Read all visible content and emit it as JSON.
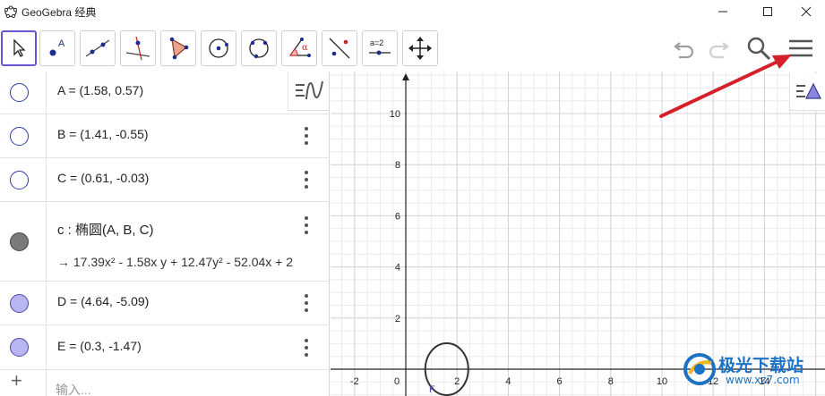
{
  "window": {
    "title": "GeoGebra 经典",
    "icon": "geogebra-logo-icon"
  },
  "toolbar": {
    "tools": [
      {
        "name": "move-tool",
        "icon": "cursor-arrow-icon",
        "active": true
      },
      {
        "name": "point-tool",
        "icon": "point-icon",
        "label": "A"
      },
      {
        "name": "line-tool",
        "icon": "line-through-points-icon"
      },
      {
        "name": "perpendicular-line-tool",
        "icon": "perpendicular-line-icon"
      },
      {
        "name": "polygon-tool",
        "icon": "polygon-icon"
      },
      {
        "name": "circle-center-point-tool",
        "icon": "circle-center-icon"
      },
      {
        "name": "circle-three-points-tool",
        "icon": "circle-three-points-icon"
      },
      {
        "name": "angle-tool",
        "icon": "angle-icon",
        "label": "α"
      },
      {
        "name": "reflect-tool",
        "icon": "reflect-line-icon"
      },
      {
        "name": "slider-tool",
        "icon": "slider-icon",
        "label": "a=2"
      },
      {
        "name": "move-graphics-tool",
        "icon": "move-arrows-icon"
      }
    ],
    "right": [
      "undo-icon",
      "redo-icon",
      "search-icon",
      "menu-icon"
    ]
  },
  "algebra": {
    "rows": [
      {
        "text": "A = (1.58, 0.57)",
        "marker": "empty"
      },
      {
        "text": "B = (1.41, -0.55)",
        "marker": "empty"
      },
      {
        "text": "C = (0.61, -0.03)",
        "marker": "empty"
      },
      {
        "text": "c : 椭圆(A, B, C)",
        "sub": "→ 17.39x² - 1.58x y + 12.47y² - 52.04x + 2",
        "marker": "gray"
      },
      {
        "text": "D = (4.64, -5.09)",
        "marker": "purple"
      },
      {
        "text": "E = (0.3, -1.47)",
        "marker": "purple"
      }
    ],
    "input_placeholder": "输入...",
    "input_plus": "+"
  },
  "graphics": {
    "x_ticks": [
      "-2",
      "0",
      "2",
      "4",
      "6",
      "8",
      "10",
      "12",
      "14"
    ],
    "y_ticks": [
      "2",
      "4",
      "6",
      "8",
      "10"
    ],
    "point_label": "F",
    "colors": {
      "grid_minor": "#ebebeb",
      "grid_major": "#d4d4d4",
      "axis": "#222222",
      "ellipse": "#333333",
      "arrow": "#d4202a"
    }
  },
  "watermark": {
    "text": "极光下载站",
    "url": "www.xz7.com"
  }
}
